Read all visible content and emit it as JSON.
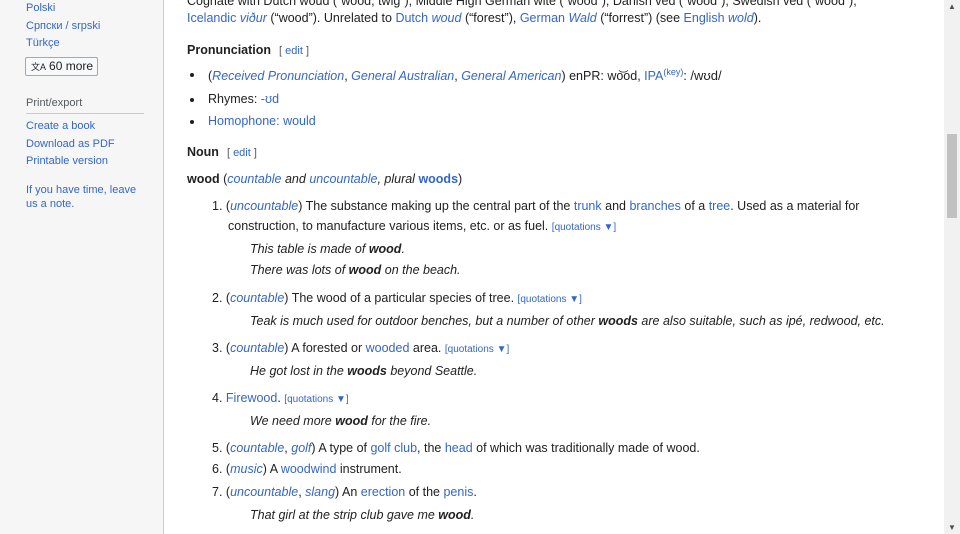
{
  "sidebar": {
    "languages": [
      "Polski",
      "Српски / srpski",
      "Türkçe"
    ],
    "more_label": "60 more",
    "print_heading": "Print/export",
    "print_links": [
      "Create a book",
      "Download as PDF",
      "Printable version"
    ],
    "note_line1": "If you have time, leave",
    "note_line2": "us a note."
  },
  "etymology": {
    "line1": "Cognate with Dutch woud (“wood, twig”), Middle High German wite (“wood”), Danish ved (“wood”), Swedish ved (“wood”),",
    "line2_a": "Icelandic ",
    "line2_b": "viður",
    "line2_c": " (“wood”). Unrelated to ",
    "line2_d": "Dutch",
    "line2_e": " ",
    "line2_f": "woud",
    "line2_g": " (“forest”), ",
    "line2_h": "German",
    "line2_i": " ",
    "line2_j": "Wald",
    "line2_k": " (“forrest”) (see ",
    "line2_l": "English",
    "line2_m": " ",
    "line2_n": "wold",
    "line2_o": ")."
  },
  "pronunciation": {
    "heading": "Pronunciation",
    "edit": "edit",
    "rp": "Received Pronunciation",
    "ga": "General Australian",
    "gam": "General American",
    "enpr": "enPR: ",
    "enpr_val": "wo͝od",
    "ipa": "IPA",
    "key": "(key)",
    "ipa_val": "/wʊd/",
    "rhymes_label": "Rhymes: ",
    "rhymes_val": "-ʊd",
    "homophone_label": "Homophone: ",
    "homophone_val": "would"
  },
  "noun": {
    "heading": "Noun",
    "edit": "edit",
    "headword": "wood",
    "countable": "countable",
    "and": " and ",
    "uncountable": "uncountable",
    "plural_text": ", plural ",
    "plural": "woods",
    "quotations": "quotations ▼",
    "senses": [
      {
        "num": "1.",
        "tag": "uncountable"
      },
      {
        "num": "2.",
        "tag": "countable",
        "text": "The wood of a particular species of tree."
      },
      {
        "num": "3.",
        "tag": "countable"
      },
      {
        "num": "4.",
        "link": "Firewood"
      },
      {
        "num": "5."
      },
      {
        "num": "6.",
        "tag": "music"
      },
      {
        "num": "7."
      }
    ],
    "s1": {
      "a": "The substance making up the central part of the ",
      "trunk": "trunk",
      "b": " and ",
      "branches": "branches",
      "c": " of a ",
      "tree": "tree",
      "d": ". Used as a material for",
      "line2": "construction, to manufacture various items, etc. or as fuel."
    },
    "s1_ex1": {
      "a": "This table is made of ",
      "b": "wood",
      "c": "."
    },
    "s1_ex2": {
      "a": "There was lots of ",
      "b": "wood",
      "c": " on the beach."
    },
    "s2_ex": {
      "a": "Teak is much used for outdoor benches, but a number of other ",
      "b": "woods",
      "c": " are also suitable, such as ipé, redwood, etc."
    },
    "s3": {
      "a": "A forested or ",
      "wooded": "wooded",
      "b": " area."
    },
    "s3_ex": {
      "a": "He got lost in the ",
      "b": "woods",
      "c": " beyond Seattle."
    },
    "s4_ex": {
      "a": "We need more ",
      "b": "wood",
      "c": " for the fire."
    },
    "s5": {
      "tag1": "countable",
      "tag2": "golf",
      "a": "A type of ",
      "golfclub": "golf club",
      "b": ", the ",
      "head": "head",
      "c": " of which was traditionally made of wood."
    },
    "s6": {
      "a": "A ",
      "woodwind": "woodwind",
      "b": " instrument."
    },
    "s7": {
      "tag1": "uncountable",
      "tag2": "slang",
      "a": "An ",
      "erection": "erection",
      "b": " of the ",
      "penis": "penis",
      "c": "."
    },
    "s7_ex": {
      "a": "That girl at the strip club gave me ",
      "b": "wood",
      "c": "."
    }
  }
}
